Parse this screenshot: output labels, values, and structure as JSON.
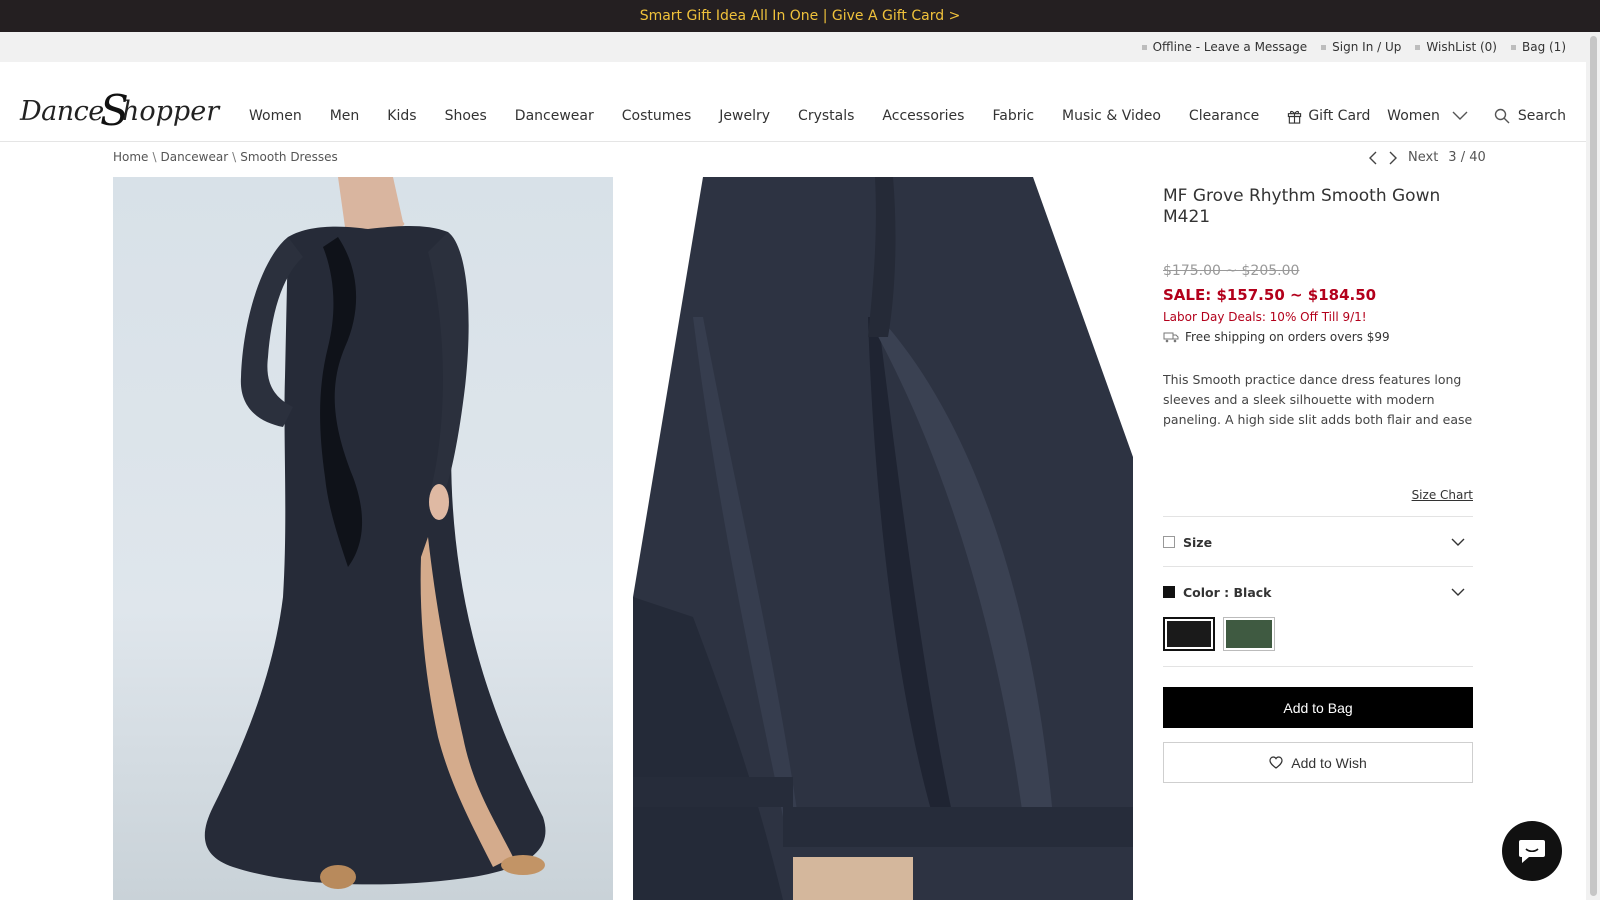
{
  "promo": {
    "text": "Smart Gift Idea All In One | Give A Gift Card >"
  },
  "util": {
    "links": [
      "Offline - Leave a Message",
      "Sign In / Up",
      "WishList (0)",
      "Bag (1)"
    ]
  },
  "logo": {
    "part1": "Dance",
    "part2": "S",
    "part3": "hopper"
  },
  "nav": {
    "items": [
      "Women",
      "Men",
      "Kids",
      "Shoes",
      "Dancewear",
      "Costumes",
      "Jewelry",
      "Crystals",
      "Accessories",
      "Fabric",
      "Music & Video",
      "Clearance",
      "Gift Card"
    ]
  },
  "header_right": {
    "category": "Women",
    "search": "Search"
  },
  "breadcrumb": {
    "items": [
      "Home",
      "Dancewear",
      "Smooth Dresses"
    ],
    "separator": "\\"
  },
  "pager": {
    "next_label": "Next",
    "position": "3 / 40"
  },
  "product": {
    "title": "MF Grove Rhythm Smooth Gown M421",
    "original_price": "$175.00 ~ $205.00",
    "sale_price": "SALE: $157.50 ~ $184.50",
    "deal": "Labor Day Deals: 10% Off Till 9/1!",
    "shipping": "Free shipping on orders overs $99",
    "description": "This Smooth practice dance dress features long sleeves and a sleek silhouette with modern paneling. A high side slit adds both flair and ease o...",
    "size_chart": "Size Chart",
    "size_label": "Size",
    "color_label": "Color : Black",
    "swatches": [
      "#1a1a1a",
      "#3f5a41"
    ],
    "add_to_bag": "Add to Bag",
    "add_to_wish": "Add to Wish"
  },
  "colors": {
    "promo_bg": "#241f21",
    "promo_text": "#f0c23b",
    "sale": "#b3001b",
    "dress": "#2b3140"
  }
}
